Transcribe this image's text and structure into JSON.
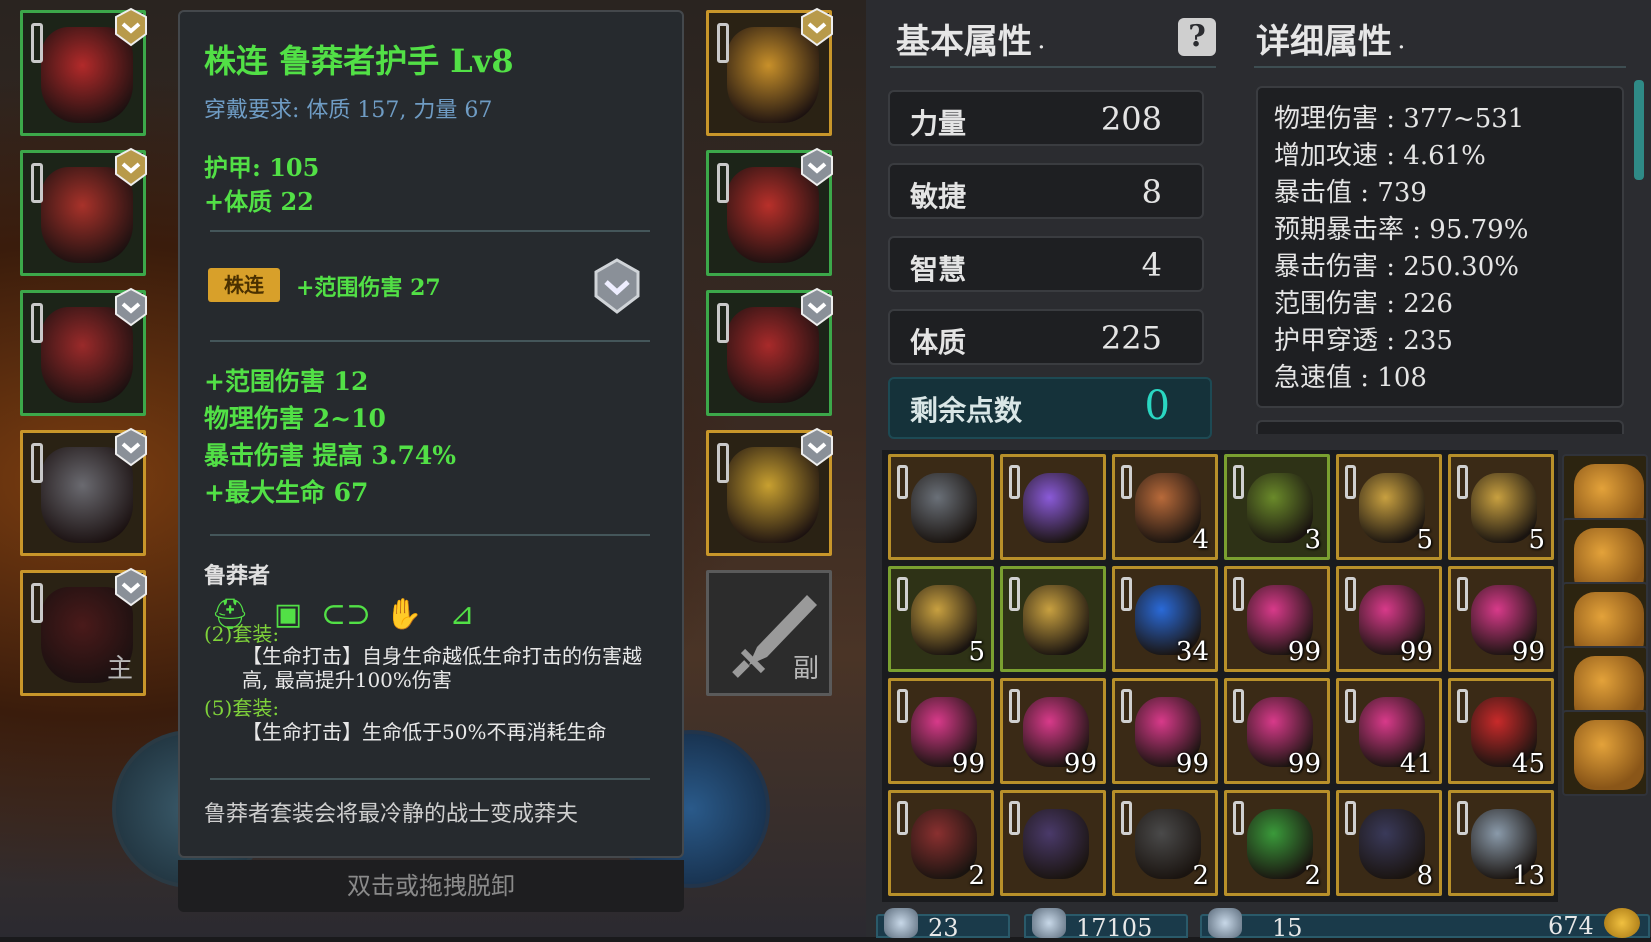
{
  "equip_left": [
    {
      "name": "helmet",
      "shield": "gold"
    },
    {
      "name": "chest",
      "shield": "gold"
    },
    {
      "name": "legs",
      "shield": "silver"
    },
    {
      "name": "ring",
      "shield": "silver"
    },
    {
      "name": "weapon-main",
      "shield": "silver",
      "tag": "主"
    }
  ],
  "equip_right": [
    {
      "name": "amulet",
      "shield": "gold"
    },
    {
      "name": "gloves",
      "shield": "silver"
    },
    {
      "name": "boots",
      "shield": "silver"
    },
    {
      "name": "ring2",
      "shield": "silver"
    },
    {
      "name": "weapon-off",
      "tag": "副"
    }
  ],
  "tooltip": {
    "title": "株连  鲁莽者护手  Lv8",
    "requirement": "穿戴要求:  体质 157, 力量 67",
    "armor": "护甲:  105",
    "base_bonus": "+体质 22",
    "tag_label": "株连",
    "tag_bonus": "+范围伤害 27",
    "affixes": [
      "+范围伤害 12",
      "物理伤害 2~10",
      "暴击伤害 提高 3.74%",
      "+最大生命 67"
    ],
    "set_name": "鲁莽者",
    "set_pieces": [
      "helmet-icon",
      "chest-icon",
      "belt-icon",
      "glove-icon",
      "boot-icon"
    ],
    "set2_title": "(2)套装:",
    "set2_desc": "【生命打击】自身生命越低生命打击的伤害越高, 最高提升100%伤害",
    "set5_title": "(5)套装:",
    "set5_desc": "【生命打击】生命低于50%不再消耗生命",
    "flavor": "鲁莽者套装会将最冷静的战士变成莽夫"
  },
  "hint": "双击或拖拽脱卸",
  "panel": {
    "basic_title": "基本属性",
    "detail_title": "详细属性",
    "help_label": "?",
    "stats": [
      {
        "label": "力量",
        "value": "208"
      },
      {
        "label": "敏捷",
        "value": "8"
      },
      {
        "label": "智慧",
        "value": "4"
      },
      {
        "label": "体质",
        "value": "225"
      }
    ],
    "remaining_label": "剩余点数",
    "remaining_value": "0",
    "details": [
      "物理伤害 : 377~531",
      "增加攻速 : 4.61%",
      "暴击值 : 739",
      "预期暴击率 : 95.79%",
      "暴击伤害 : 250.30%",
      "范围伤害 : 226",
      "护甲穿透 : 235",
      "急速值 : 108"
    ]
  },
  "inventory": [
    {
      "item": "claw",
      "count": "",
      "color": "#6a7078"
    },
    {
      "item": "amethyst",
      "count": "",
      "color": "#8a5ad8"
    },
    {
      "item": "red-scroll",
      "count": "4",
      "color": "#b86a3a"
    },
    {
      "item": "rune-disc",
      "count": "3",
      "color": "#6a8a2a",
      "green": true
    },
    {
      "item": "scroll",
      "count": "5",
      "color": "#c8a040"
    },
    {
      "item": "scroll",
      "count": "5",
      "color": "#c8a040"
    },
    {
      "item": "scroll",
      "count": "5",
      "color": "#c8a040",
      "green": true
    },
    {
      "item": "scroll",
      "count": "",
      "color": "#c8a040",
      "green": true
    },
    {
      "item": "blue-orb",
      "count": "34",
      "color": "#2a6ad8"
    },
    {
      "item": "pink-gem",
      "count": "99",
      "color": "#d83a8a"
    },
    {
      "item": "pink-gem",
      "count": "99",
      "color": "#d83a8a"
    },
    {
      "item": "pink-gem",
      "count": "99",
      "color": "#d83a8a"
    },
    {
      "item": "pink-gem",
      "count": "99",
      "color": "#d83a8a"
    },
    {
      "item": "pink-gem",
      "count": "99",
      "color": "#d83a8a"
    },
    {
      "item": "pink-gem",
      "count": "99",
      "color": "#d83a8a"
    },
    {
      "item": "pink-gem",
      "count": "99",
      "color": "#d83a8a"
    },
    {
      "item": "pink-gem",
      "count": "41",
      "color": "#d83a8a"
    },
    {
      "item": "red-crystal",
      "count": "45",
      "color": "#c82a2a"
    },
    {
      "item": "red-ore",
      "count": "2",
      "color": "#8a3030"
    },
    {
      "item": "purple-ore",
      "count": "",
      "color": "#4a3a6a"
    },
    {
      "item": "dark-ore",
      "count": "2",
      "color": "#4a4a4a"
    },
    {
      "item": "green-potion",
      "count": "2",
      "color": "#3a9a3a"
    },
    {
      "item": "dark-cloth",
      "count": "8",
      "color": "#3a3a5a"
    },
    {
      "item": "silver-ore",
      "count": "13",
      "color": "#8a9aaa"
    }
  ],
  "currency": [
    {
      "icon": "crystal-icon",
      "value": "23"
    },
    {
      "icon": "shield-currency-icon",
      "value": "17105"
    },
    {
      "icon": "gem-icon",
      "value": "15"
    },
    {
      "icon": "gold-coin-icon",
      "value": "674"
    }
  ]
}
